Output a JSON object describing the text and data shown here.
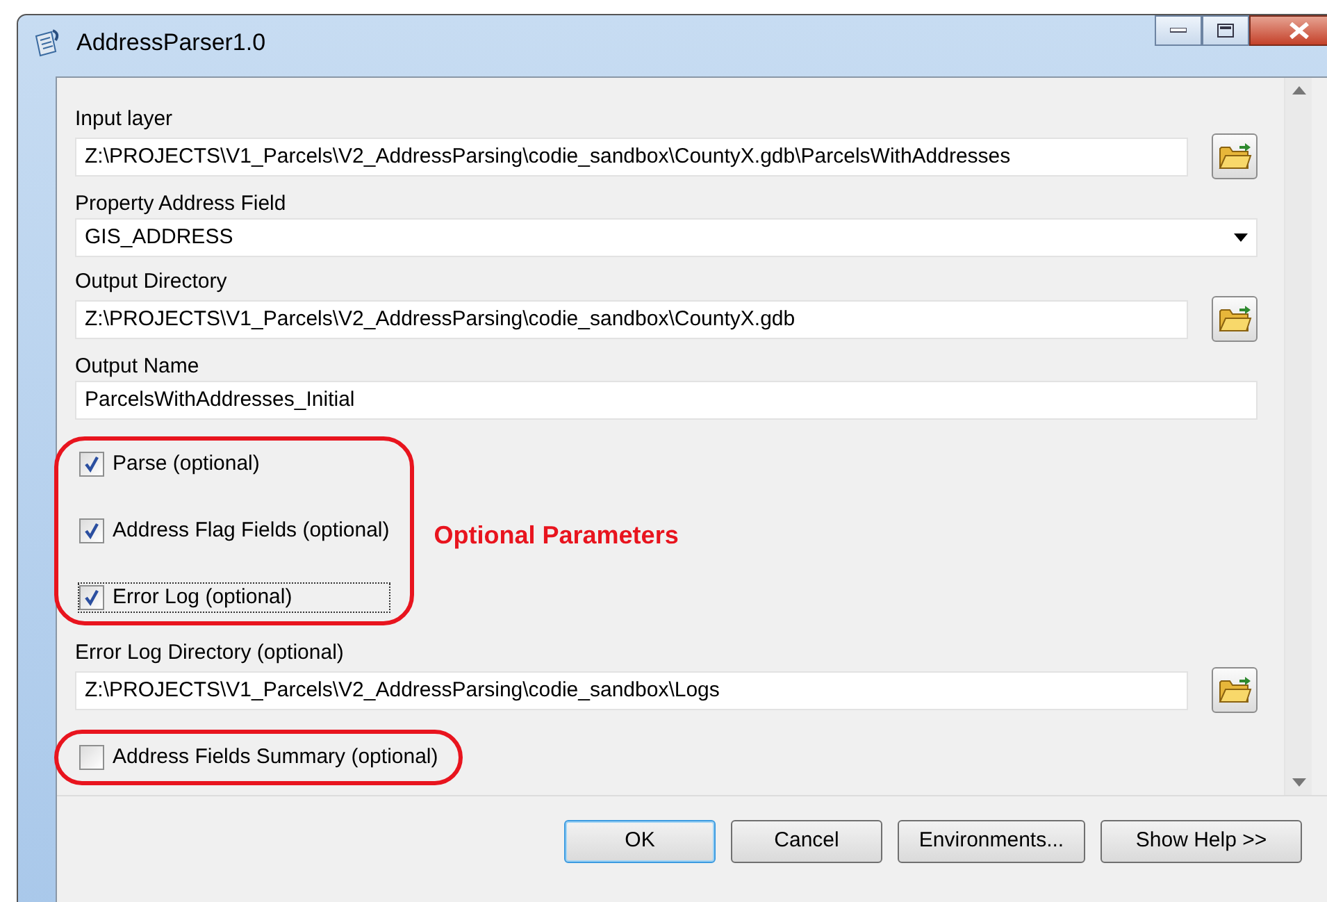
{
  "window": {
    "title": "AddressParser1.0"
  },
  "parameters": [
    {
      "kind": "path",
      "label": "Input layer",
      "value": "Z:\\PROJECTS\\V1_Parcels\\V2_AddressParsing\\codie_sandbox\\CountyX.gdb\\ParcelsWithAddresses"
    },
    {
      "kind": "dropdown",
      "label": "Property Address Field",
      "value": "GIS_ADDRESS"
    },
    {
      "kind": "path",
      "label": "Output Directory",
      "value": "Z:\\PROJECTS\\V1_Parcels\\V2_AddressParsing\\codie_sandbox\\CountyX.gdb"
    },
    {
      "kind": "text",
      "label": "Output Name",
      "value": "ParcelsWithAddresses_Initial"
    },
    {
      "kind": "callout",
      "note": "Optional Parameters",
      "items": [
        {
          "label": "Parse (optional)",
          "checked": true,
          "focused": false
        },
        {
          "label": "Address Flag Fields (optional)",
          "checked": true,
          "focused": false
        },
        {
          "label": "Error Log (optional)",
          "checked": true,
          "focused": true
        }
      ]
    },
    {
      "kind": "path",
      "label": "Error Log Directory (optional)",
      "value": "Z:\\PROJECTS\\V1_Parcels\\V2_AddressParsing\\codie_sandbox\\Logs"
    },
    {
      "kind": "callout",
      "items": [
        {
          "label": "Address Fields Summary (optional)",
          "checked": false,
          "focused": false
        }
      ]
    }
  ],
  "buttons": [
    {
      "label": "OK",
      "default": true
    },
    {
      "label": "Cancel",
      "default": false
    },
    {
      "label": "Environments...",
      "default": false
    },
    {
      "label": "Show Help >>",
      "default": false
    }
  ]
}
